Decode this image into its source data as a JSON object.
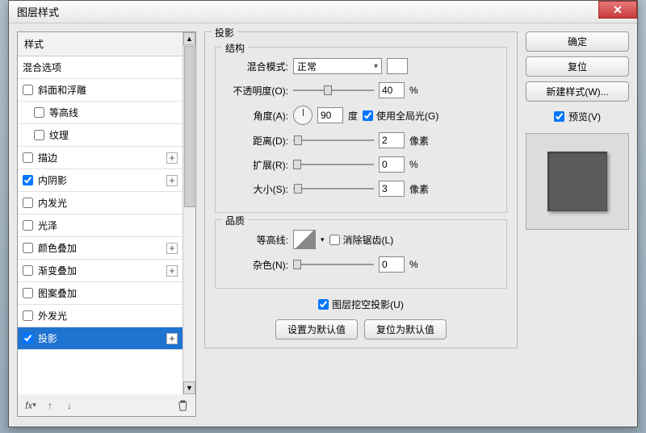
{
  "dialog": {
    "title": "图层样式"
  },
  "left": {
    "header": "样式",
    "blend_options": "混合选项",
    "items": [
      {
        "label": "斜面和浮雕",
        "checked": false,
        "plus": false,
        "indent": false
      },
      {
        "label": "等高线",
        "checked": false,
        "plus": false,
        "indent": true
      },
      {
        "label": "纹理",
        "checked": false,
        "plus": false,
        "indent": true
      },
      {
        "label": "描边",
        "checked": false,
        "plus": true,
        "indent": false
      },
      {
        "label": "内阴影",
        "checked": true,
        "plus": true,
        "indent": false
      },
      {
        "label": "内发光",
        "checked": false,
        "plus": false,
        "indent": false
      },
      {
        "label": "光泽",
        "checked": false,
        "plus": false,
        "indent": false
      },
      {
        "label": "颜色叠加",
        "checked": false,
        "plus": true,
        "indent": false
      },
      {
        "label": "渐变叠加",
        "checked": false,
        "plus": true,
        "indent": false
      },
      {
        "label": "图案叠加",
        "checked": false,
        "plus": false,
        "indent": false
      },
      {
        "label": "外发光",
        "checked": false,
        "plus": false,
        "indent": false
      },
      {
        "label": "投影",
        "checked": true,
        "plus": true,
        "indent": false,
        "selected": true
      }
    ]
  },
  "center": {
    "title": "投影",
    "structure_title": "结构",
    "blend_mode_label": "混合模式:",
    "blend_mode_value": "正常",
    "opacity_label": "不透明度(O):",
    "opacity_value": "40",
    "percent": "%",
    "angle_label": "角度(A):",
    "angle_value": "90",
    "degree": "度",
    "global_light_label": "使用全局光(G)",
    "distance_label": "距离(D):",
    "distance_value": "2",
    "px": "像素",
    "spread_label": "扩展(R):",
    "spread_value": "0",
    "size_label": "大小(S):",
    "size_value": "3",
    "quality_title": "品质",
    "contour_label": "等高线:",
    "antialias_label": "消除锯齿(L)",
    "noise_label": "杂色(N):",
    "noise_value": "0",
    "knockout_label": "图层挖空投影(U)",
    "default_btn": "设置为默认值",
    "reset_btn": "复位为默认值"
  },
  "right": {
    "ok": "确定",
    "reset": "复位",
    "new_style": "新建样式(W)...",
    "preview": "预览(V)"
  }
}
